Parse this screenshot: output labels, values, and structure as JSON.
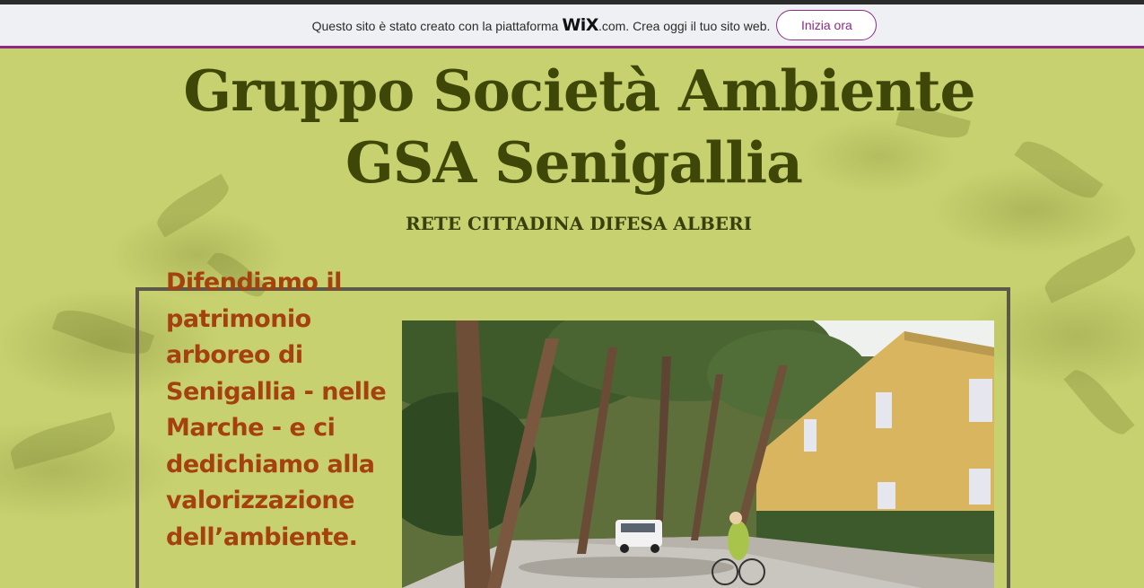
{
  "wix_banner": {
    "text_before": "Questo sito è stato creato con la piattaforma",
    "logo": "WiX",
    "text_after": ".com. Crea oggi il tuo sito web.",
    "button_label": "Inizia ora",
    "accent_color": "#8c2a86"
  },
  "header": {
    "title_line1": "Gruppo Società Ambiente",
    "title_line2": "GSA Senigallia",
    "subtitle": "RETE CITTADINA DIFESA ALBERI"
  },
  "main": {
    "headline": "Difendiamo il patrimonio arboreo di Senigallia - nelle Marche - e ci dedichiamo alla valorizzazione dell’ambiente."
  },
  "colors": {
    "background": "#c7d16f",
    "title": "#3f4708",
    "headline": "#a5410e",
    "frame": "#5e5846"
  }
}
